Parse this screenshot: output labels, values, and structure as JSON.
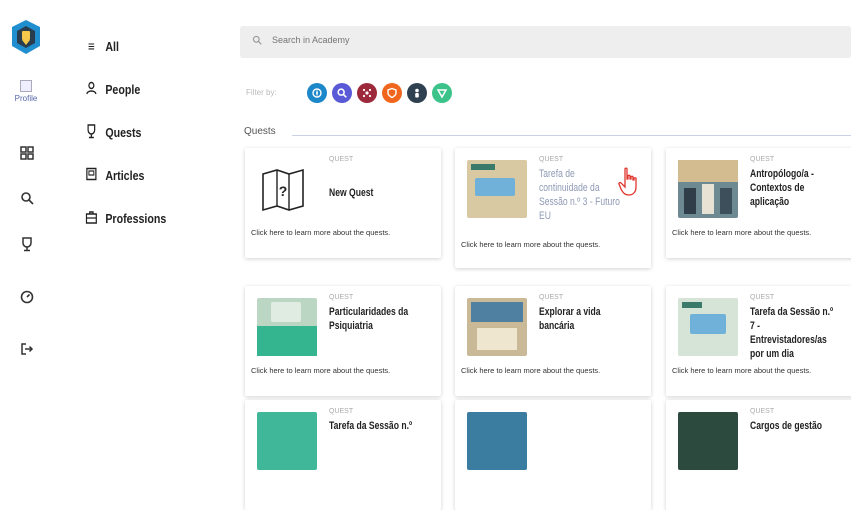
{
  "sidebar": {
    "profile_label": "Profile"
  },
  "menu": [
    {
      "label": "All",
      "icon": "list-icon"
    },
    {
      "label": "People",
      "icon": "people-icon"
    },
    {
      "label": "Quests",
      "icon": "trophy-icon"
    },
    {
      "label": "Articles",
      "icon": "article-icon"
    },
    {
      "label": "Professions",
      "icon": "briefcase-icon"
    }
  ],
  "search": {
    "placeholder": "Search in Academy"
  },
  "filters": {
    "label": "Filter by:",
    "colors": [
      "#1c87c9",
      "#5a59d6",
      "#9c2a3a",
      "#f0661d",
      "#2f4150",
      "#3bc38a"
    ]
  },
  "section": {
    "title": "Quests"
  },
  "cards": [
    {
      "tag": "QUEST",
      "title": "New Quest",
      "desc": "Click here to learn more about the quests."
    },
    {
      "tag": "QUEST",
      "title": "Tarefa de continuidade da Sessão n.º 3 - Futuro EU",
      "desc": "Click here to learn more about the quests."
    },
    {
      "tag": "QUEST",
      "title": "Antropólogo/a - Contextos de aplicação",
      "desc": "Click here to learn more about the quests."
    },
    {
      "tag": "QUEST",
      "title": "Particularidades da Psiquiatria",
      "desc": "Click here to learn more about the quests."
    },
    {
      "tag": "QUEST",
      "title": "Explorar a vida bancária",
      "desc": "Click here to learn more about the quests."
    },
    {
      "tag": "QUEST",
      "title": "Tarefa da Sessão n.º 7 - Entrevistadores/as por um dia",
      "desc": "Click here to learn more about the quests."
    },
    {
      "tag": "QUEST",
      "title": "Tarefa da Sessão n.º",
      "desc": ""
    },
    {
      "tag": "",
      "title": "",
      "desc": ""
    },
    {
      "tag": "QUEST",
      "title": "Cargos de gestão",
      "desc": ""
    }
  ]
}
